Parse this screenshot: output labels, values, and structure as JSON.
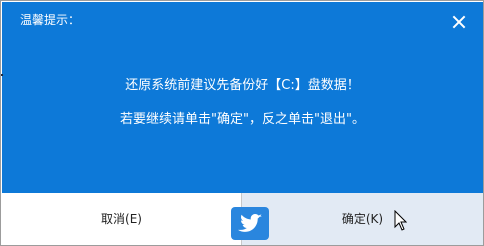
{
  "dialog": {
    "title": "温馨提示：",
    "close_icon": "close-icon",
    "message_line1": "还原系统前建议先备份好【C:】盘数据！",
    "message_line2": "若要继续请单击\"确定\"，反之单击\"退出\"。",
    "buttons": {
      "cancel_label": "取消(E)",
      "confirm_label": "确定(K)"
    },
    "colors": {
      "panel": "#0d79d8",
      "text": "#ffffff",
      "confirm_background": "#e2eaf4",
      "button_text": "#222222"
    },
    "overlay_icons": {
      "badge": "twitter-bird-icon",
      "pointer": "mouse-cursor-icon"
    }
  }
}
